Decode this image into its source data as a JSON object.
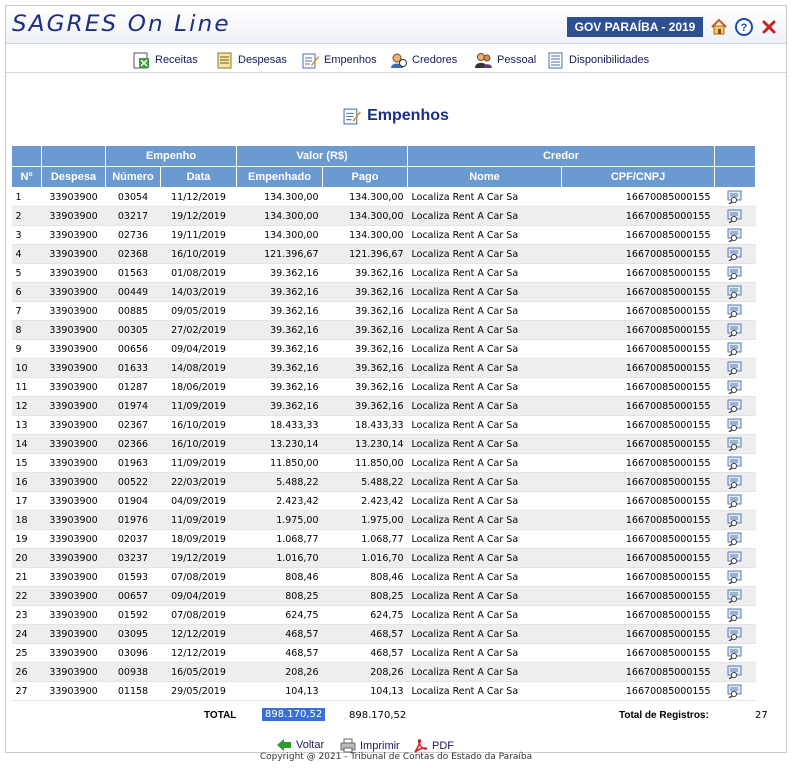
{
  "header": {
    "logo": "SAGRES On Line",
    "gov_badge": "GOV PARAÍBA - 2019"
  },
  "menu": {
    "items": [
      {
        "label": "Receitas",
        "icon": "receitas-icon"
      },
      {
        "label": "Despesas",
        "icon": "despesas-icon"
      },
      {
        "label": "Empenhos",
        "icon": "empenhos-icon"
      },
      {
        "label": "Credores",
        "icon": "credores-icon"
      },
      {
        "label": "Pessoal",
        "icon": "pessoal-icon"
      },
      {
        "label": "Disponibilidades",
        "icon": "disponibilidades-icon"
      }
    ]
  },
  "page": {
    "title": "Empenhos"
  },
  "table": {
    "groups": {
      "empenho": "Empenho",
      "valor": "Valor (R$)",
      "credor": "Credor"
    },
    "columns": {
      "n": "Nº",
      "despesa": "Despesa",
      "numero": "Número",
      "data": "Data",
      "empenhado": "Empenhado",
      "pago": "Pago",
      "nome": "Nome",
      "cpf": "CPF/CNPJ"
    },
    "rows": [
      {
        "n": "1",
        "despesa": "33903900",
        "numero": "03054",
        "data": "11/12/2019",
        "empenhado": "134.300,00",
        "pago": "134.300,00",
        "nome": "Localiza Rent A Car Sa",
        "cpf": "16670085000155"
      },
      {
        "n": "2",
        "despesa": "33903900",
        "numero": "03217",
        "data": "19/12/2019",
        "empenhado": "134.300,00",
        "pago": "134.300,00",
        "nome": "Localiza Rent A Car Sa",
        "cpf": "16670085000155"
      },
      {
        "n": "3",
        "despesa": "33903900",
        "numero": "02736",
        "data": "19/11/2019",
        "empenhado": "134.300,00",
        "pago": "134.300,00",
        "nome": "Localiza Rent A Car Sa",
        "cpf": "16670085000155"
      },
      {
        "n": "4",
        "despesa": "33903900",
        "numero": "02368",
        "data": "16/10/2019",
        "empenhado": "121.396,67",
        "pago": "121.396,67",
        "nome": "Localiza Rent A Car Sa",
        "cpf": "16670085000155"
      },
      {
        "n": "5",
        "despesa": "33903900",
        "numero": "01563",
        "data": "01/08/2019",
        "empenhado": "39.362,16",
        "pago": "39.362,16",
        "nome": "Localiza Rent A Car Sa",
        "cpf": "16670085000155"
      },
      {
        "n": "6",
        "despesa": "33903900",
        "numero": "00449",
        "data": "14/03/2019",
        "empenhado": "39.362,16",
        "pago": "39.362,16",
        "nome": "Localiza Rent A Car Sa",
        "cpf": "16670085000155"
      },
      {
        "n": "7",
        "despesa": "33903900",
        "numero": "00885",
        "data": "09/05/2019",
        "empenhado": "39.362,16",
        "pago": "39.362,16",
        "nome": "Localiza Rent A Car Sa",
        "cpf": "16670085000155"
      },
      {
        "n": "8",
        "despesa": "33903900",
        "numero": "00305",
        "data": "27/02/2019",
        "empenhado": "39.362,16",
        "pago": "39.362,16",
        "nome": "Localiza Rent A Car Sa",
        "cpf": "16670085000155"
      },
      {
        "n": "9",
        "despesa": "33903900",
        "numero": "00656",
        "data": "09/04/2019",
        "empenhado": "39.362,16",
        "pago": "39.362,16",
        "nome": "Localiza Rent A Car Sa",
        "cpf": "16670085000155"
      },
      {
        "n": "10",
        "despesa": "33903900",
        "numero": "01633",
        "data": "14/08/2019",
        "empenhado": "39.362,16",
        "pago": "39.362,16",
        "nome": "Localiza Rent A Car Sa",
        "cpf": "16670085000155"
      },
      {
        "n": "11",
        "despesa": "33903900",
        "numero": "01287",
        "data": "18/06/2019",
        "empenhado": "39.362,16",
        "pago": "39.362,16",
        "nome": "Localiza Rent A Car Sa",
        "cpf": "16670085000155"
      },
      {
        "n": "12",
        "despesa": "33903900",
        "numero": "01974",
        "data": "11/09/2019",
        "empenhado": "39.362,16",
        "pago": "39.362,16",
        "nome": "Localiza Rent A Car Sa",
        "cpf": "16670085000155"
      },
      {
        "n": "13",
        "despesa": "33903900",
        "numero": "02367",
        "data": "16/10/2019",
        "empenhado": "18.433,33",
        "pago": "18.433,33",
        "nome": "Localiza Rent A Car Sa",
        "cpf": "16670085000155"
      },
      {
        "n": "14",
        "despesa": "33903900",
        "numero": "02366",
        "data": "16/10/2019",
        "empenhado": "13.230,14",
        "pago": "13.230,14",
        "nome": "Localiza Rent A Car Sa",
        "cpf": "16670085000155"
      },
      {
        "n": "15",
        "despesa": "33903900",
        "numero": "01963",
        "data": "11/09/2019",
        "empenhado": "11.850,00",
        "pago": "11.850,00",
        "nome": "Localiza Rent A Car Sa",
        "cpf": "16670085000155"
      },
      {
        "n": "16",
        "despesa": "33903900",
        "numero": "00522",
        "data": "22/03/2019",
        "empenhado": "5.488,22",
        "pago": "5.488,22",
        "nome": "Localiza Rent A Car Sa",
        "cpf": "16670085000155"
      },
      {
        "n": "17",
        "despesa": "33903900",
        "numero": "01904",
        "data": "04/09/2019",
        "empenhado": "2.423,42",
        "pago": "2.423,42",
        "nome": "Localiza Rent A Car Sa",
        "cpf": "16670085000155"
      },
      {
        "n": "18",
        "despesa": "33903900",
        "numero": "01976",
        "data": "11/09/2019",
        "empenhado": "1.975,00",
        "pago": "1.975,00",
        "nome": "Localiza Rent A Car Sa",
        "cpf": "16670085000155"
      },
      {
        "n": "19",
        "despesa": "33903900",
        "numero": "02037",
        "data": "18/09/2019",
        "empenhado": "1.068,77",
        "pago": "1.068,77",
        "nome": "Localiza Rent A Car Sa",
        "cpf": "16670085000155"
      },
      {
        "n": "20",
        "despesa": "33903900",
        "numero": "03237",
        "data": "19/12/2019",
        "empenhado": "1.016,70",
        "pago": "1.016,70",
        "nome": "Localiza Rent A Car Sa",
        "cpf": "16670085000155"
      },
      {
        "n": "21",
        "despesa": "33903900",
        "numero": "01593",
        "data": "07/08/2019",
        "empenhado": "808,46",
        "pago": "808,46",
        "nome": "Localiza Rent A Car Sa",
        "cpf": "16670085000155"
      },
      {
        "n": "22",
        "despesa": "33903900",
        "numero": "00657",
        "data": "09/04/2019",
        "empenhado": "808,25",
        "pago": "808,25",
        "nome": "Localiza Rent A Car Sa",
        "cpf": "16670085000155"
      },
      {
        "n": "23",
        "despesa": "33903900",
        "numero": "01592",
        "data": "07/08/2019",
        "empenhado": "624,75",
        "pago": "624,75",
        "nome": "Localiza Rent A Car Sa",
        "cpf": "16670085000155"
      },
      {
        "n": "24",
        "despesa": "33903900",
        "numero": "03095",
        "data": "12/12/2019",
        "empenhado": "468,57",
        "pago": "468,57",
        "nome": "Localiza Rent A Car Sa",
        "cpf": "16670085000155"
      },
      {
        "n": "25",
        "despesa": "33903900",
        "numero": "03096",
        "data": "12/12/2019",
        "empenhado": "468,57",
        "pago": "468,57",
        "nome": "Localiza Rent A Car Sa",
        "cpf": "16670085000155"
      },
      {
        "n": "26",
        "despesa": "33903900",
        "numero": "00938",
        "data": "16/05/2019",
        "empenhado": "208,26",
        "pago": "208,26",
        "nome": "Localiza Rent A Car Sa",
        "cpf": "16670085000155"
      },
      {
        "n": "27",
        "despesa": "33903900",
        "numero": "01158",
        "data": "29/05/2019",
        "empenhado": "104,13",
        "pago": "104,13",
        "nome": "Localiza Rent A Car Sa",
        "cpf": "16670085000155"
      }
    ]
  },
  "totals": {
    "label": "TOTAL",
    "empenhado": "898.170,52",
    "pago": "898.170,52",
    "registros_label": "Total de Registros:",
    "registros": "27"
  },
  "actions": {
    "voltar": "Voltar",
    "imprimir": "Imprimir",
    "pdf": "PDF"
  },
  "footer": "Copyright @ 2021 - Tribunal de Contas do Estado da Paraíba",
  "colors": {
    "brand": "#1b2e86",
    "header_blue": "#6b9ad0",
    "badge_blue": "#2f4f93",
    "selection": "#3b6fd8"
  }
}
